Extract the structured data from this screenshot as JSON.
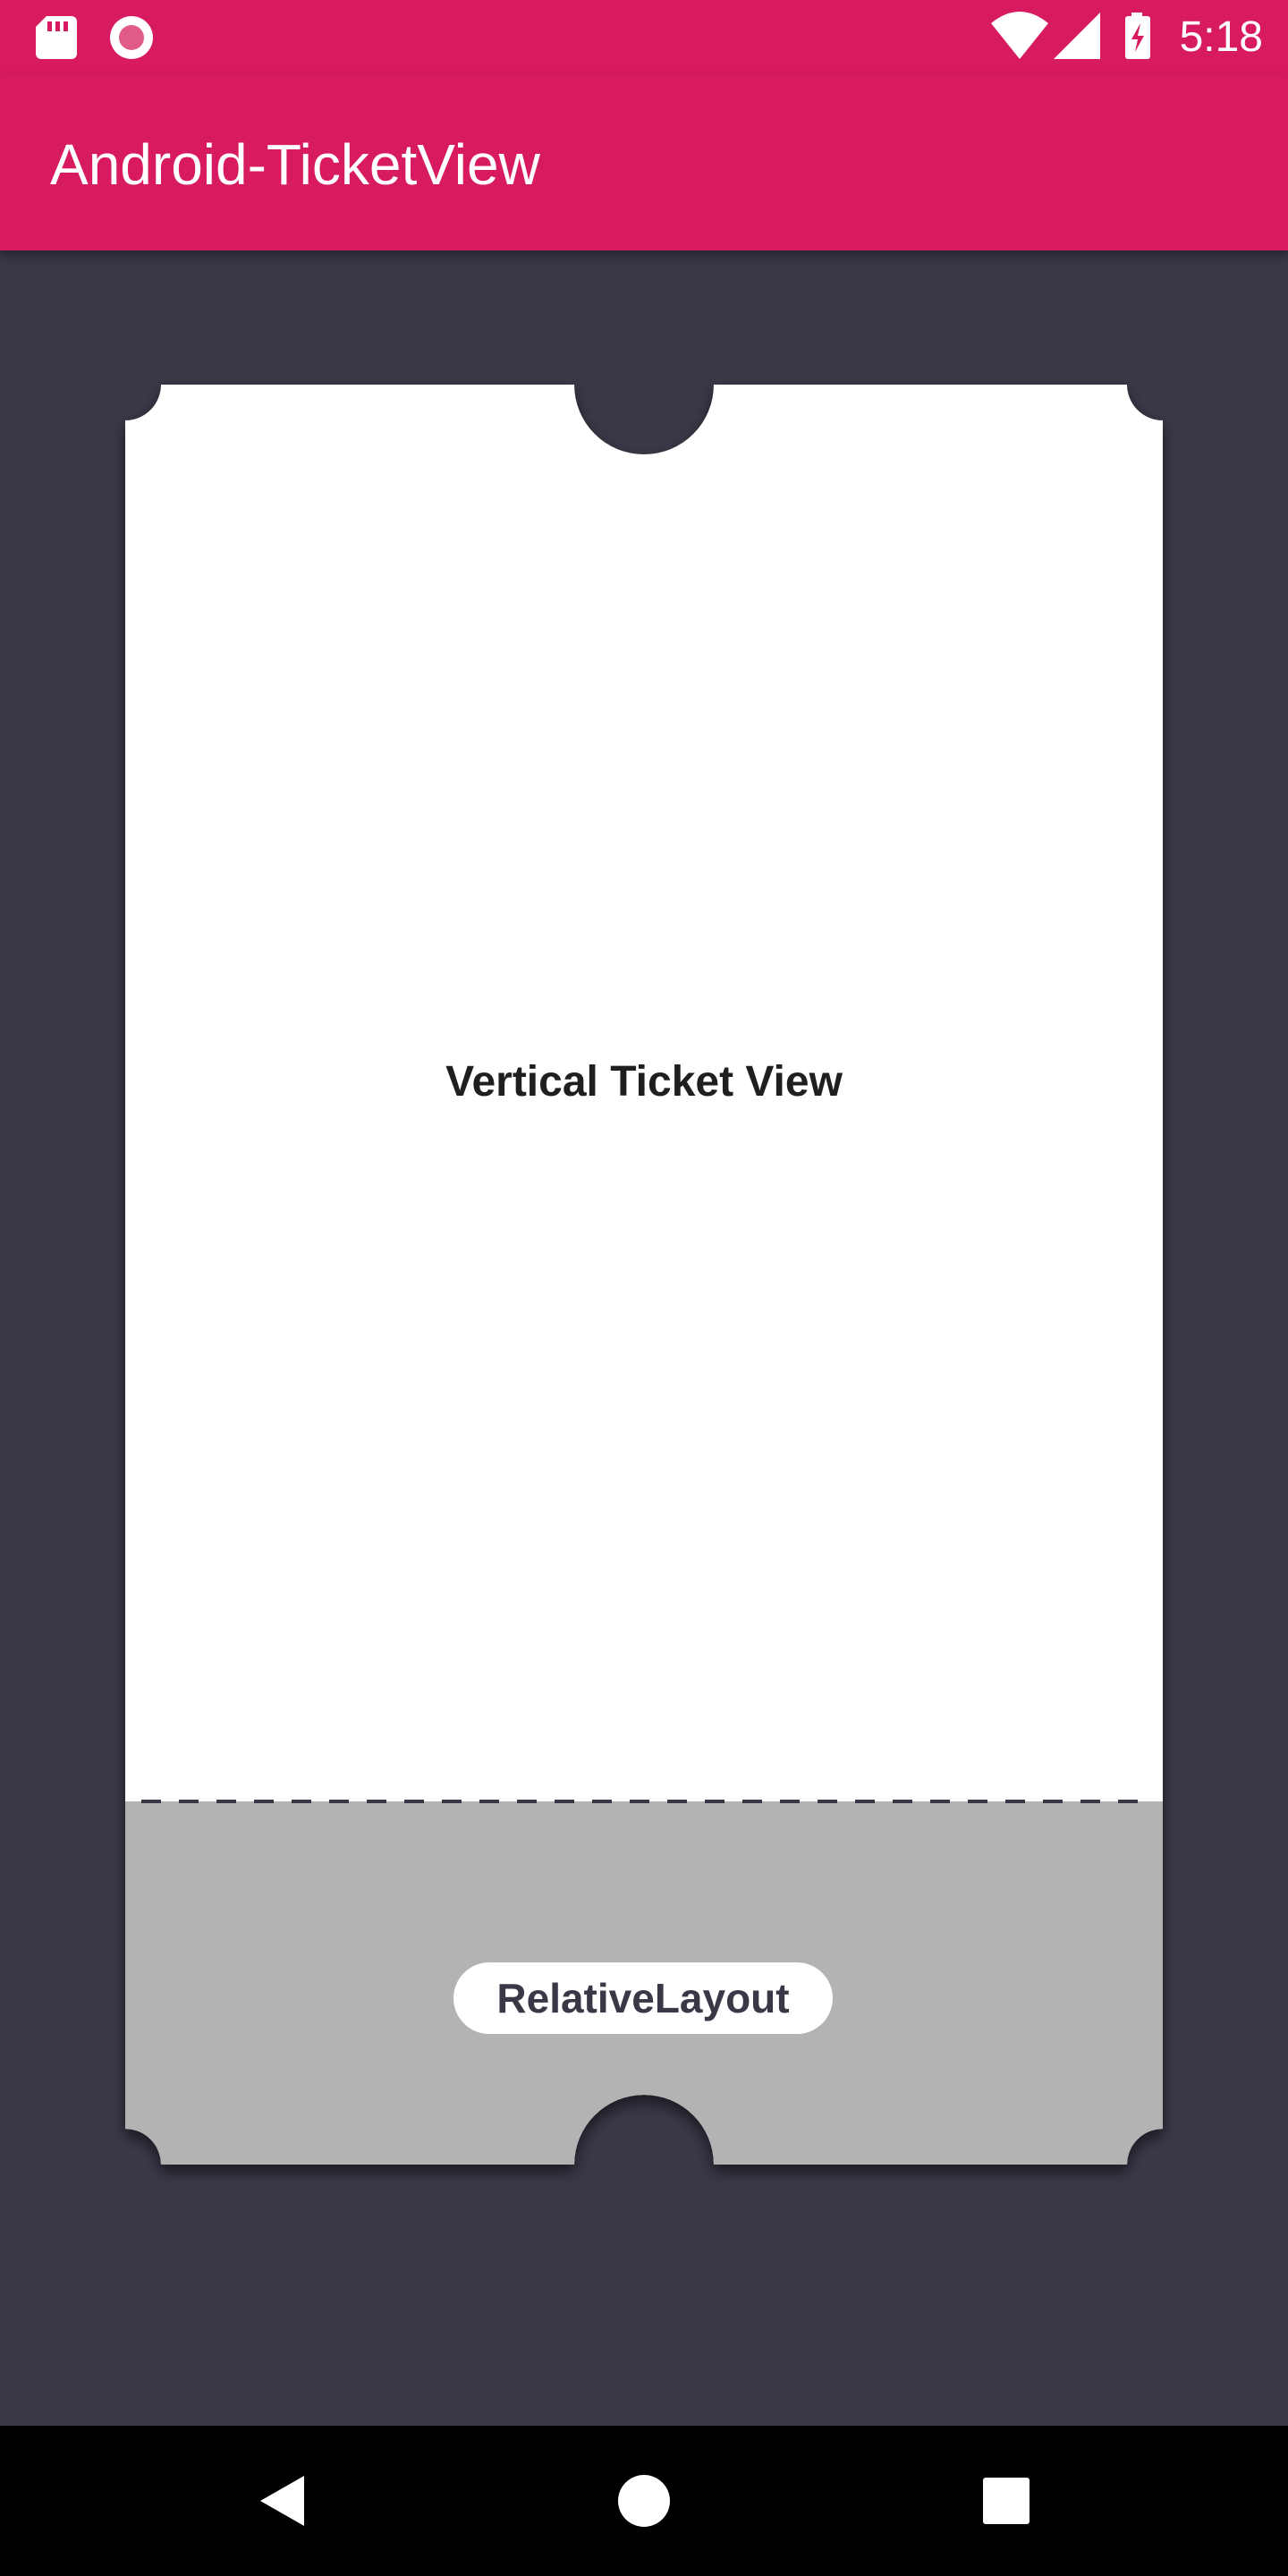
{
  "status_bar": {
    "time": "5:18",
    "left_icons": [
      "sd-card-icon",
      "record-icon"
    ],
    "right_icons": [
      "wifi-icon",
      "signal-icon",
      "battery-charging-icon"
    ]
  },
  "app_bar": {
    "title": "Android-TicketView",
    "color": "#D81B60"
  },
  "ticket": {
    "title": "Vertical Ticket View",
    "button_label": "RelativeLayout",
    "top_color": "#FFFFFF",
    "bottom_color": "#B3B3B3",
    "background_color": "#383847"
  },
  "nav_bar": {
    "buttons": [
      "back-icon",
      "home-icon",
      "recents-icon"
    ]
  }
}
